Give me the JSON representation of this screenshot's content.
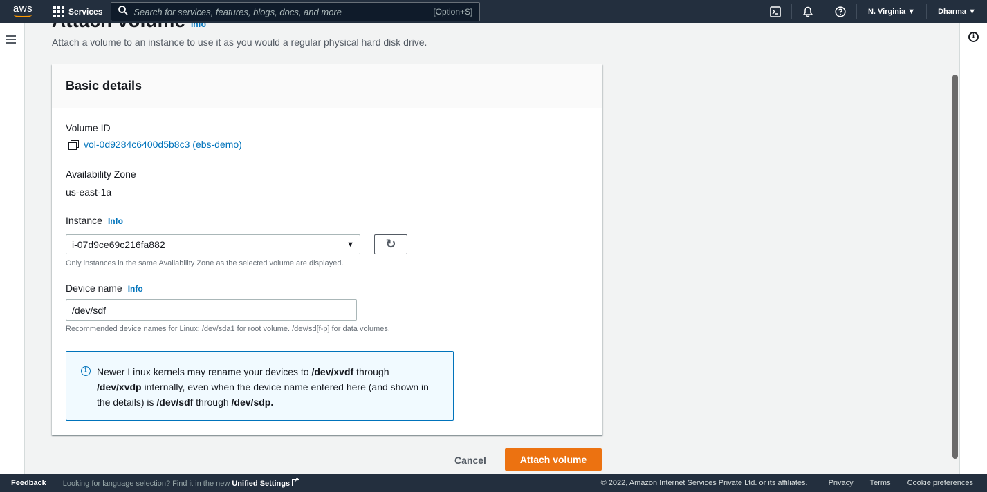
{
  "topnav": {
    "logo": "aws",
    "services_label": "Services",
    "search_placeholder": "Search for services, features, blogs, docs, and more",
    "search_shortcut": "[Option+S]",
    "icons": [
      "cloudshell-icon",
      "bell-icon",
      "help-icon"
    ],
    "region": "N. Virginia ▼",
    "user": "Dharma ▼"
  },
  "page": {
    "title": "Attach volume",
    "title_info": "Info",
    "subtitle": "Attach a volume to an instance to use it as you would a regular physical hard disk drive."
  },
  "card": {
    "title": "Basic details",
    "volume_id_label": "Volume ID",
    "volume_id_value": "vol-0d9284c6400d5b8c3 (ebs-demo)",
    "az_label": "Availability Zone",
    "az_value": "us-east-1a",
    "instance_label": "Instance",
    "instance_info": "Info",
    "instance_value": "i-07d9ce69c216fa882",
    "instance_hint": "Only instances in the same Availability Zone as the selected volume are displayed.",
    "device_label": "Device name",
    "device_info": "Info",
    "device_value": "/dev/sdf",
    "device_hint": "Recommended device names for Linux: /dev/sda1 for root volume. /dev/sd[f-p] for data volumes.",
    "alert": {
      "t1": "Newer Linux kernels may rename your devices to ",
      "b1": "/dev/xvdf",
      "t2": " through ",
      "b2": "/dev/xvdp",
      "t3": " internally, even when the device name entered here (and shown in the details) is ",
      "b3": "/dev/sdf",
      "t4": " through ",
      "b4": "/dev/sdp."
    }
  },
  "actions": {
    "cancel": "Cancel",
    "attach": "Attach volume"
  },
  "footer": {
    "feedback": "Feedback",
    "lang_text": "Looking for language selection? Find it in the new ",
    "lang_link": "Unified Settings",
    "copyright": "© 2022, Amazon Internet Services Private Ltd. or its affiliates.",
    "privacy": "Privacy",
    "terms": "Terms",
    "cookies": "Cookie preferences"
  },
  "colors": {
    "nav_bg": "#232f3e",
    "primary": "#ec7211",
    "link": "#0073bb",
    "alert_bg": "#f1faff"
  }
}
